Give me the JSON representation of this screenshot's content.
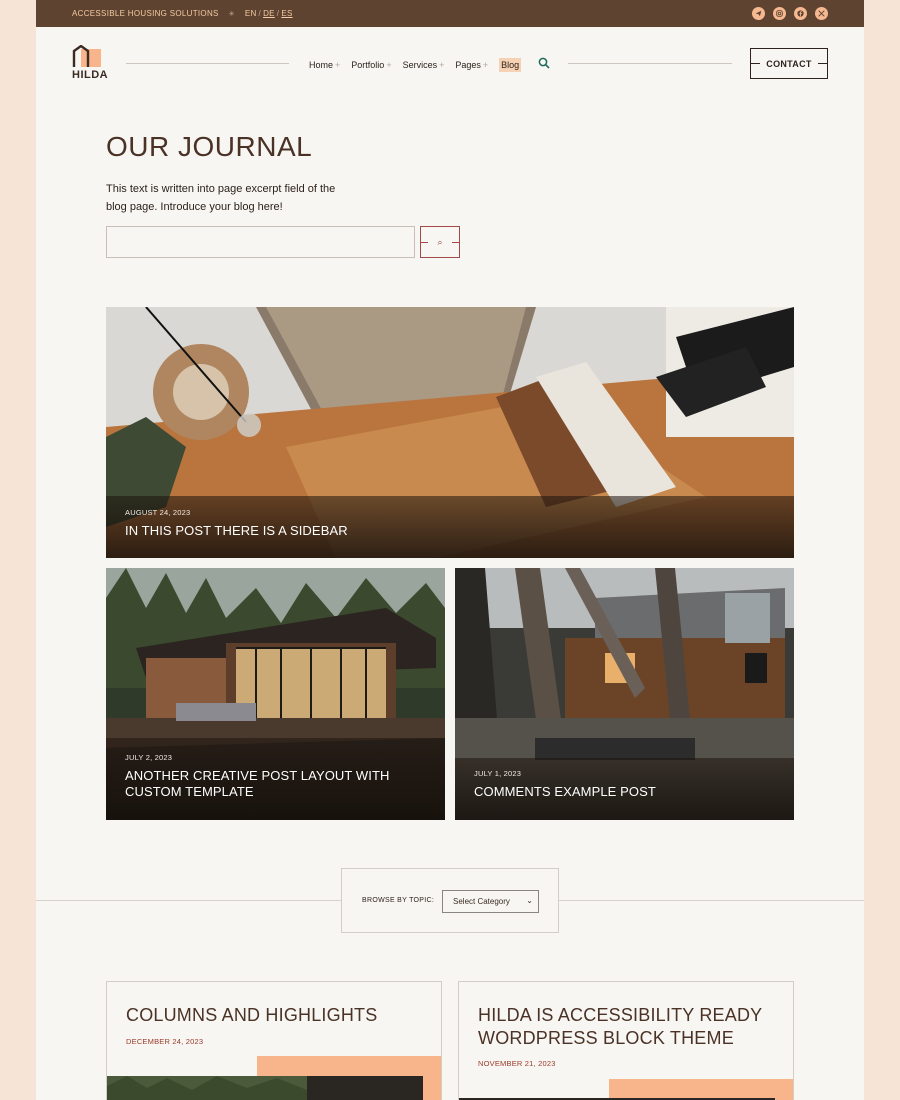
{
  "topbar": {
    "tagline": "ACCESSIBLE HOUSING SOLUTIONS",
    "separator": "✳",
    "languages": [
      "EN",
      "DE",
      "ES"
    ],
    "social": [
      "telegram-icon",
      "instagram-icon",
      "facebook-icon",
      "x-icon"
    ]
  },
  "header": {
    "logo_text": "HILDA",
    "nav": [
      {
        "label": "Home",
        "has_submenu": true
      },
      {
        "label": "Portfolio",
        "has_submenu": true
      },
      {
        "label": "Services",
        "has_submenu": true
      },
      {
        "label": "Pages",
        "has_submenu": true
      },
      {
        "label": "Blog",
        "has_submenu": false,
        "active": true
      }
    ],
    "contact_label": "CONTACT"
  },
  "hero": {
    "title": "OUR JOURNAL",
    "excerpt": "This text is written into page excerpt field of the blog page. Introduce your blog here!",
    "search_placeholder": "",
    "search_button": "⌕"
  },
  "featured_posts": [
    {
      "date": "AUGUST 24, 2023",
      "title": "IN THIS POST THERE IS A SIDEBAR"
    },
    {
      "date": "JULY 2, 2023",
      "title": "ANOTHER CREATIVE POST LAYOUT WITH CUSTOM TEMPLATE"
    },
    {
      "date": "JULY 1, 2023",
      "title": "COMMENTS EXAMPLE POST"
    }
  ],
  "browse": {
    "label": "BROWSE BY TOPIC:",
    "select_value": "Select Category"
  },
  "posts": [
    {
      "title": "COLUMNS AND HIGHLIGHTS",
      "date": "DECEMBER 24, 2023"
    },
    {
      "title": "HILDA IS ACCESSIBILITY READY WORDPRESS BLOCK THEME",
      "date": "NOVEMBER 21, 2023"
    }
  ],
  "colors": {
    "topbar_bg": "#5e4430",
    "accent": "#f8b58c",
    "page_bg": "#f8f6f2",
    "outer_bg": "#f6e4d6",
    "date_red": "#9a3a2a"
  }
}
